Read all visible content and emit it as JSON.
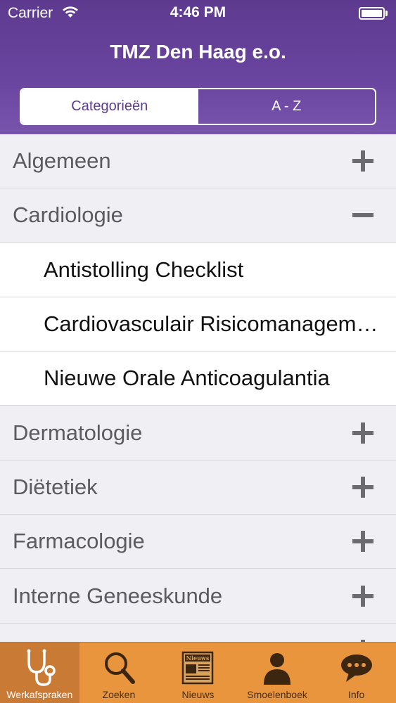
{
  "status_bar": {
    "carrier": "Carrier",
    "time": "4:46 PM",
    "icons": [
      "wifi-icon",
      "battery-icon"
    ]
  },
  "nav": {
    "title": "TMZ Den Haag e.o."
  },
  "segmented_control": {
    "segments": [
      "Categorieën",
      "A - Z"
    ],
    "selected": "Categorieën"
  },
  "list": {
    "rows": [
      {
        "type": "category",
        "label": "Algemeen",
        "expanded": false,
        "icon": "plus-icon"
      },
      {
        "type": "category",
        "label": "Cardiologie",
        "expanded": true,
        "icon": "minus-icon"
      },
      {
        "type": "item",
        "label": "Antistolling Checklist"
      },
      {
        "type": "item",
        "label": "Cardiovasculair Risicomanagement"
      },
      {
        "type": "item",
        "label": "Nieuwe Orale Anticoagulantia"
      },
      {
        "type": "category",
        "label": "Dermatologie",
        "expanded": false,
        "icon": "plus-icon"
      },
      {
        "type": "category",
        "label": "Diëtetiek",
        "expanded": false,
        "icon": "plus-icon"
      },
      {
        "type": "category",
        "label": "Farmacologie",
        "expanded": false,
        "icon": "plus-icon"
      },
      {
        "type": "category",
        "label": "Interne Geneeskunde",
        "expanded": false,
        "icon": "plus-icon"
      }
    ]
  },
  "tabbar": {
    "tabs": [
      {
        "label": "Werkafspraken",
        "icon": "stethoscope-icon",
        "selected": true
      },
      {
        "label": "Zoeken",
        "icon": "search-icon",
        "selected": false
      },
      {
        "label": "Nieuws",
        "icon": "newspaper-icon",
        "selected": false,
        "icon_text": "Nieuws"
      },
      {
        "label": "Smoelenboek",
        "icon": "person-icon",
        "selected": false
      },
      {
        "label": "Info",
        "icon": "chat-bubble-icon",
        "selected": false
      }
    ]
  },
  "colors": {
    "header": "#6a45a0",
    "tabbar": "#e8953e",
    "tabbar_selected": "#c97b35",
    "list_background": "#efeff4"
  }
}
